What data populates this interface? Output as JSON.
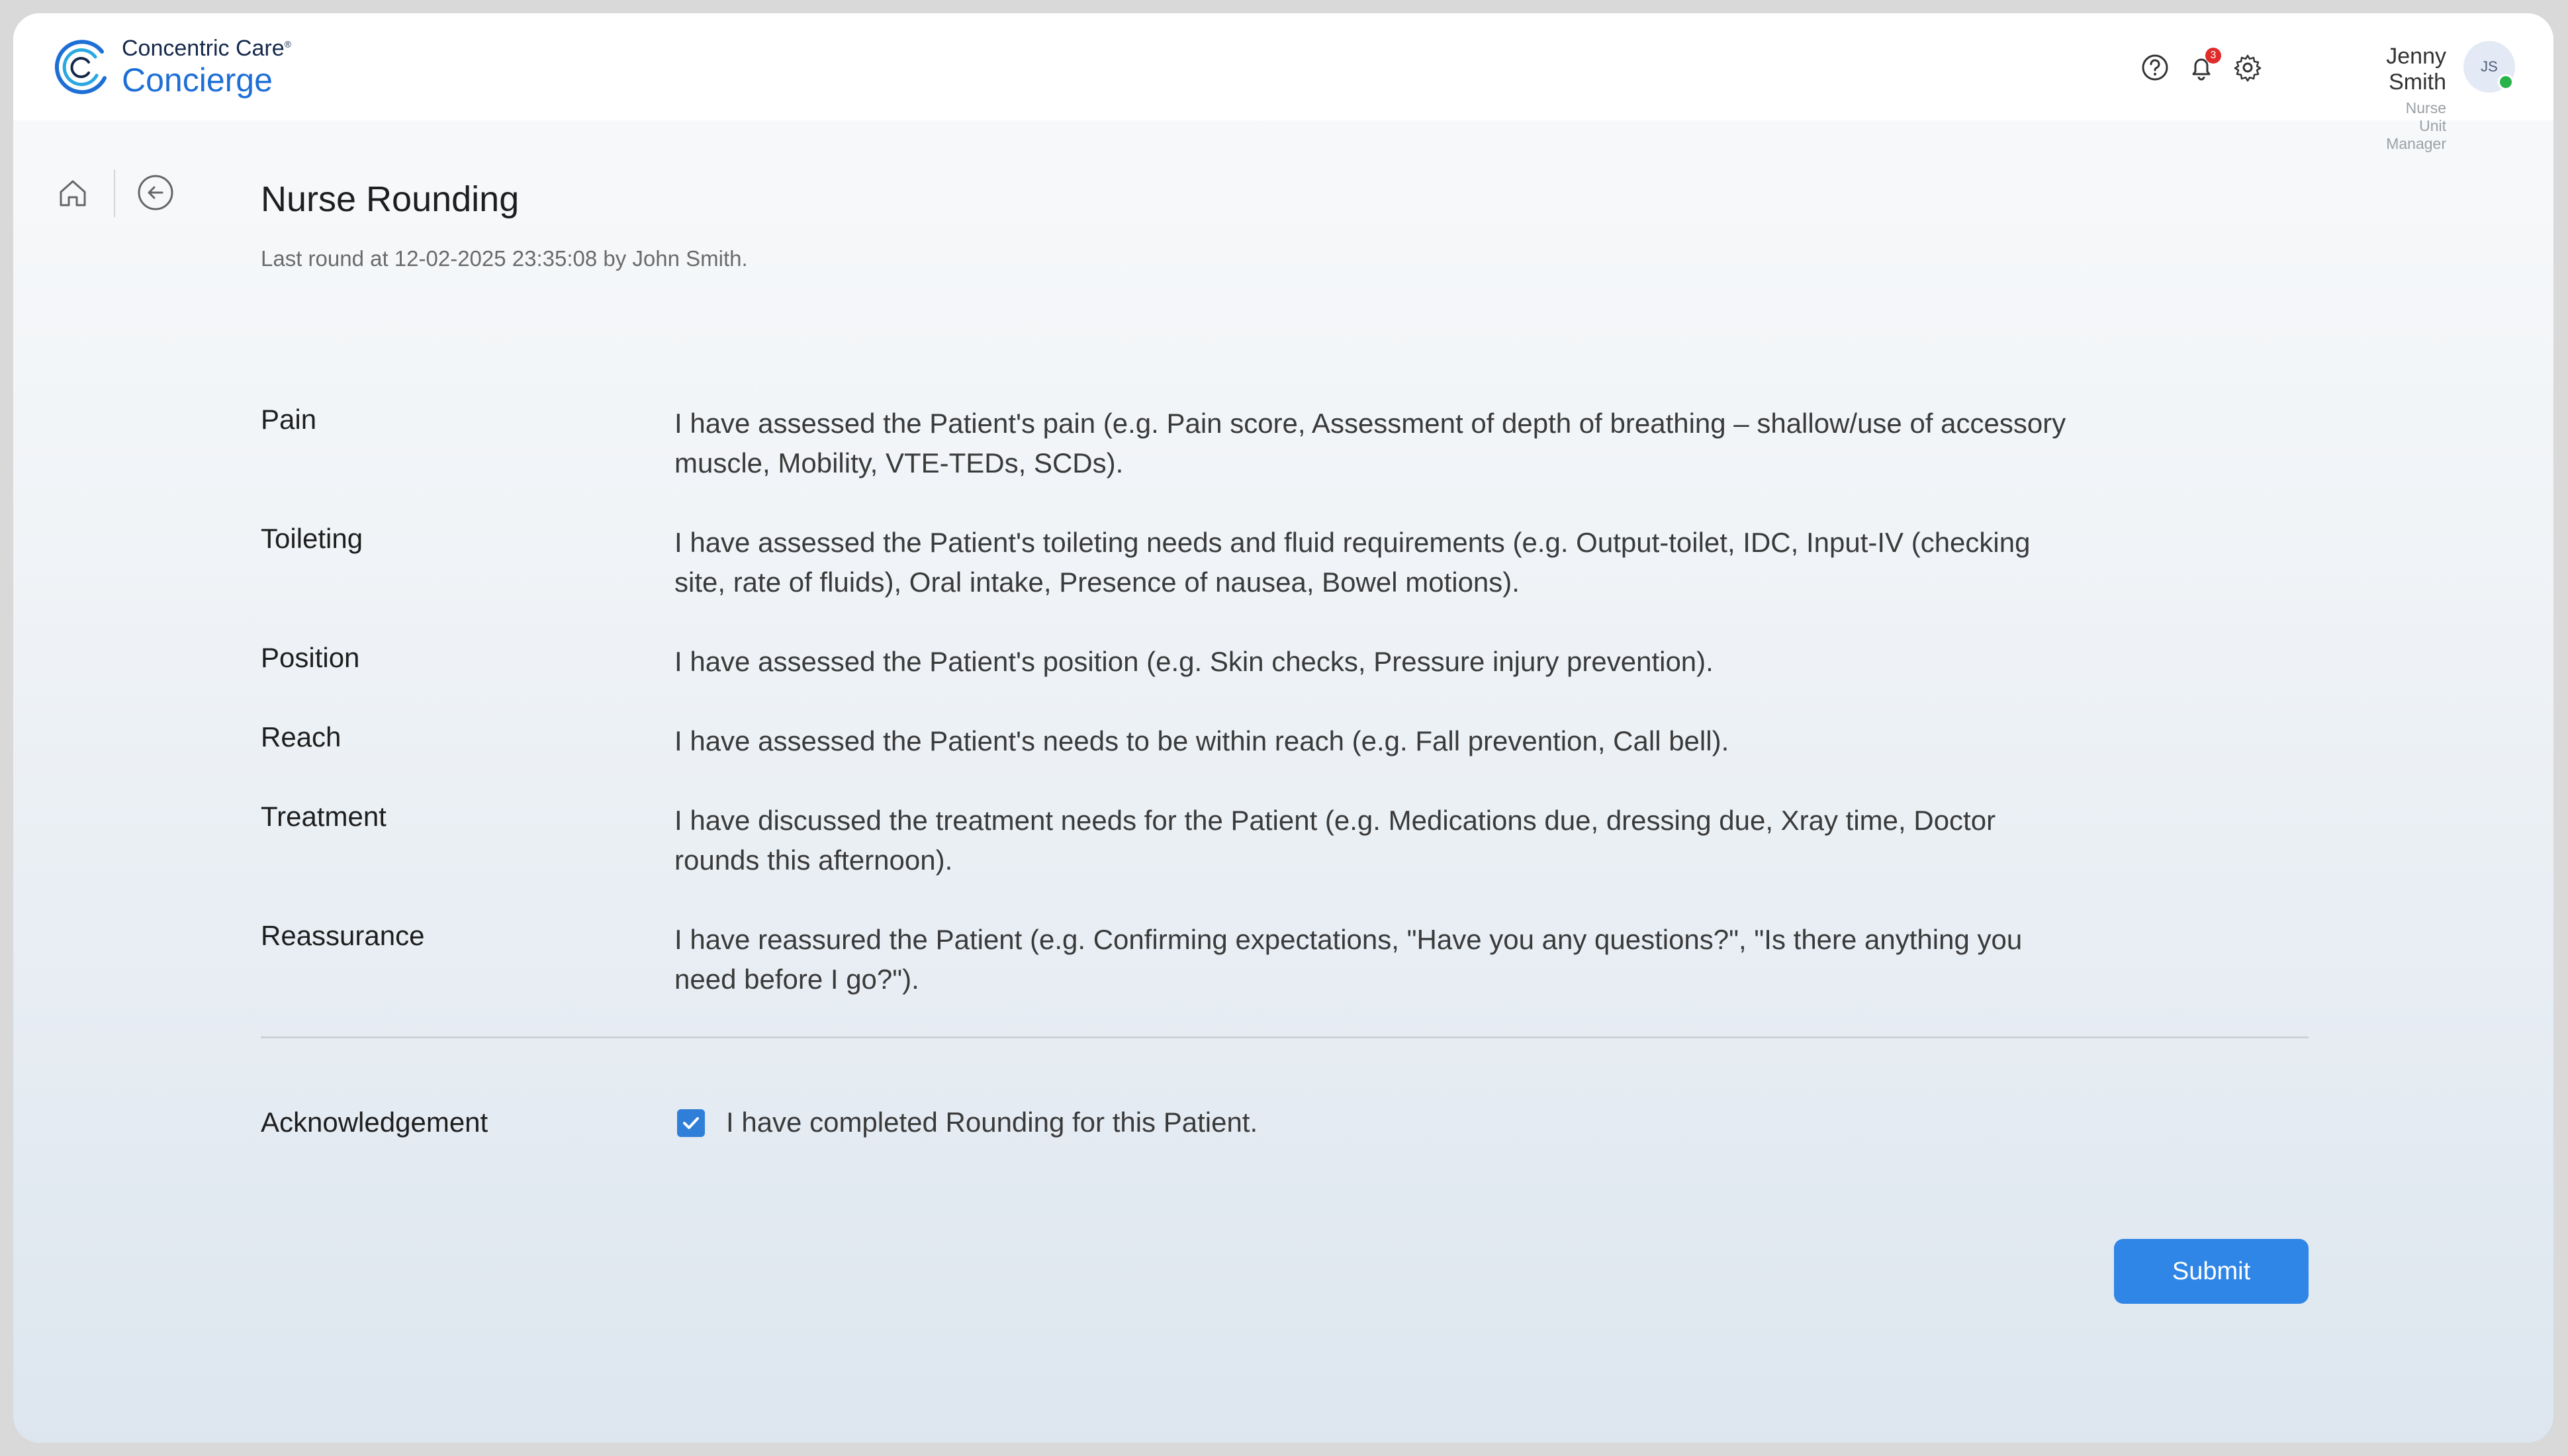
{
  "app": {
    "company": "Concentric Care",
    "trademark": "®",
    "product": "Concierge",
    "brand_color": "#1d6fd6"
  },
  "header": {
    "help_icon": "help-circle-icon",
    "notification_icon": "bell-icon",
    "notification_count": "3",
    "settings_icon": "gear-icon",
    "user": {
      "name": "Jenny Smith",
      "role": "Nurse Unit Manager",
      "initials": "JS",
      "status_color": "#28b34a"
    }
  },
  "nav": {
    "home_icon": "home-icon",
    "back_icon": "back-arrow-circle-icon"
  },
  "page": {
    "title": "Nurse Rounding",
    "subtitle": "Last round at 12-02-2025 23:35:08 by John Smith."
  },
  "rounding": [
    {
      "label": "Pain",
      "text": "I have assessed the Patient's pain (e.g. Pain score, Assessment of depth of breathing – shallow/use of accessory muscle, Mobility, VTE-TEDs, SCDs)."
    },
    {
      "label": "Toileting",
      "text": "I have assessed the Patient's toileting needs and fluid requirements (e.g. Output-toilet, IDC, Input-IV (checking site, rate of fluids), Oral intake, Presence of nausea, Bowel motions)."
    },
    {
      "label": "Position",
      "text": "I have assessed the Patient's position (e.g. Skin checks, Pressure injury prevention)."
    },
    {
      "label": "Reach",
      "text": "I have assessed the Patient's needs to be within reach (e.g. Fall prevention, Call bell)."
    },
    {
      "label": "Treatment",
      "text": "I have discussed the treatment needs for the Patient (e.g. Medications due, dressing due, Xray time, Doctor rounds this afternoon)."
    },
    {
      "label": "Reassurance",
      "text": "I have reassured the Patient (e.g. Confirming expectations, \"Have you any questions?\", \"Is there anything you need before I go?\")."
    }
  ],
  "acknowledgement": {
    "label": "Acknowledgement",
    "text": "I have completed Rounding for this Patient.",
    "checked": true
  },
  "actions": {
    "submit_label": "Submit",
    "submit_color": "#2f86e6"
  }
}
